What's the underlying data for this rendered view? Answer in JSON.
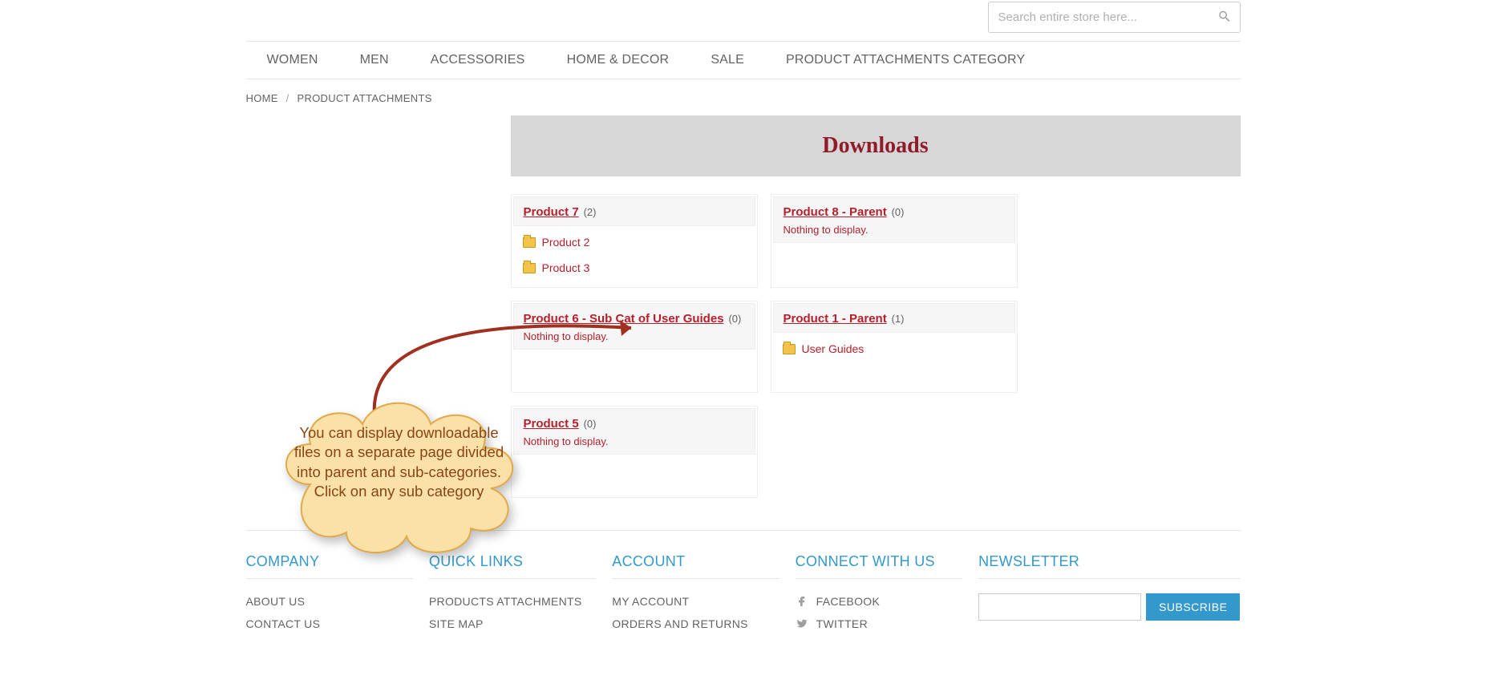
{
  "search": {
    "placeholder": "Search entire store here..."
  },
  "nav": {
    "items": [
      "WOMEN",
      "MEN",
      "ACCESSORIES",
      "HOME & DECOR",
      "SALE",
      "PRODUCT ATTACHMENTS CATEGORY"
    ]
  },
  "breadcrumb": {
    "home": "HOME",
    "sep": "/",
    "current": "PRODUCT ATTACHMENTS"
  },
  "page": {
    "title": "Downloads"
  },
  "cards": [
    {
      "title": "Product 7",
      "count": "(2)",
      "children": [
        "Product 2",
        "Product 3"
      ],
      "empty": ""
    },
    {
      "title": "Product 8 - Parent",
      "count": "(0)",
      "children": [],
      "empty": "Nothing to display."
    },
    {
      "title": "Product 6 - Sub Cat of User Guides",
      "count": "(0)",
      "children": [],
      "empty": "Nothing to display."
    },
    {
      "title": "Product 1 - Parent",
      "count": "(1)",
      "children": [
        "User Guides"
      ],
      "empty": ""
    },
    {
      "title": "Product 5",
      "count": "(0)",
      "children": [],
      "empty": "Nothing to display."
    }
  ],
  "annotation": {
    "text": "You can display downloadable files on a separate page divided into parent and sub-categories. Click on any sub category"
  },
  "footer": {
    "company": {
      "title": "COMPANY",
      "links": [
        "ABOUT US",
        "CONTACT US"
      ]
    },
    "quick": {
      "title": "QUICK LINKS",
      "links": [
        "PRODUCTS ATTACHMENTS",
        "SITE MAP"
      ]
    },
    "account": {
      "title": "ACCOUNT",
      "links": [
        "MY ACCOUNT",
        "ORDERS AND RETURNS"
      ]
    },
    "connect": {
      "title": "CONNECT WITH US",
      "links": [
        "FACEBOOK",
        "TWITTER"
      ]
    },
    "newsletter": {
      "title": "NEWSLETTER",
      "button": "SUBSCRIBE"
    }
  }
}
